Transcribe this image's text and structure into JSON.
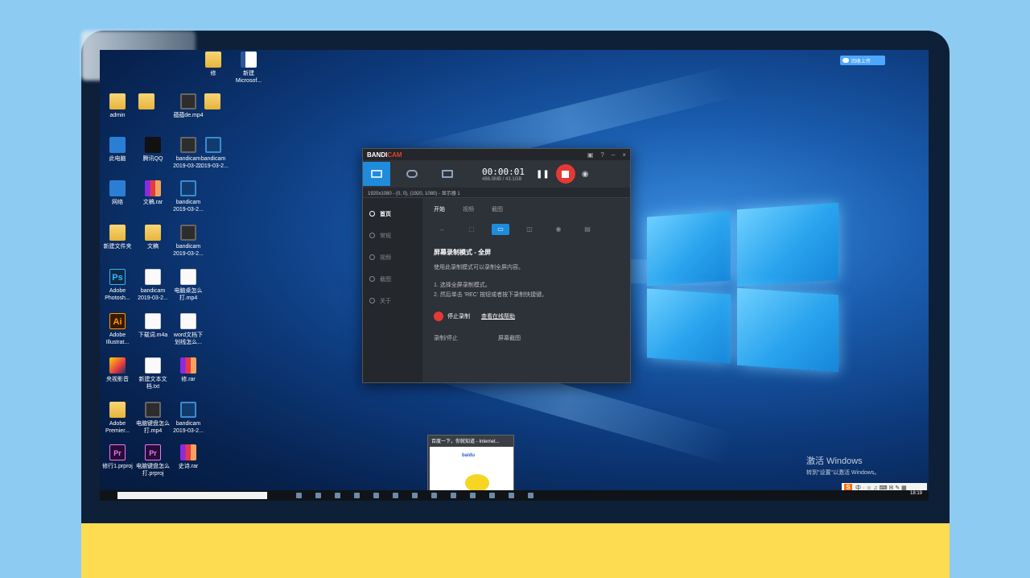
{
  "desktop": {
    "icons": [
      {
        "label": "修",
        "glyph": "folder"
      },
      {
        "label": "新建 Microsof...",
        "glyph": "word"
      },
      {
        "label": "admin",
        "glyph": "folder"
      },
      {
        "label": "",
        "glyph": "folder"
      },
      {
        "label": "蕴蕴de.mp4",
        "glyph": "video"
      },
      {
        "label": "",
        "glyph": "folder"
      },
      {
        "label": "此电脑",
        "glyph": "blue"
      },
      {
        "label": "腾讯QQ",
        "glyph": "qq"
      },
      {
        "label": "bandicam 2019-03-2...",
        "glyph": "video"
      },
      {
        "label": "bandicam 2019-03-2...",
        "glyph": "vid2"
      },
      {
        "label": "网络",
        "glyph": "blue"
      },
      {
        "label": "文稿.rar",
        "glyph": "rar"
      },
      {
        "label": "bandicam 2019-03-2...",
        "glyph": "vid2"
      },
      {
        "label": "新建文件夹",
        "glyph": "folder"
      },
      {
        "label": "文稿",
        "glyph": "folder"
      },
      {
        "label": "bandicam 2019-03-2...",
        "glyph": "video"
      },
      {
        "label": "Adobe Photosh...",
        "glyph": "ps"
      },
      {
        "label": "bandicam 2019-03-2...",
        "glyph": "white"
      },
      {
        "label": "电脑桌怎么 打.mp4",
        "glyph": "white"
      },
      {
        "label": "Adobe Illustrat...",
        "glyph": "ai"
      },
      {
        "label": "下载词.m4a",
        "glyph": "white"
      },
      {
        "label": "word文档下 划线怎么...",
        "glyph": "white"
      },
      {
        "label": "央视影音",
        "glyph": "yellow"
      },
      {
        "label": "新建文本文 档.txt",
        "glyph": "white"
      },
      {
        "label": "修.rar",
        "glyph": "rar"
      },
      {
        "label": "Adobe Premier...",
        "glyph": "folder"
      },
      {
        "label": "电脑键盘怎么 打.mp4",
        "glyph": "video"
      },
      {
        "label": "bandicam 2019-03-2...",
        "glyph": "vid2"
      },
      {
        "label": "修行1.prproj",
        "glyph": "pr"
      },
      {
        "label": "电脑键盘怎么 打.prproj",
        "glyph": "pr"
      },
      {
        "label": "史诗.rar",
        "glyph": "rar"
      }
    ]
  },
  "bandicam": {
    "brand_main": "BANDI",
    "brand_accent": "CAM",
    "controls": [
      "▣",
      "?",
      "–",
      "×"
    ],
    "timer": "00:00:01",
    "size": "486.0MB / 43.1GB",
    "pause": "❚❚",
    "camera": "◉",
    "resolution": "1920x1080 - (0, 0), (1920, 1080) - 显示器 1",
    "nav": [
      "首页",
      "常规",
      "视频",
      "截图",
      "关于"
    ],
    "subtabs": [
      "开始",
      "视频",
      "截图"
    ],
    "mode_icons": [
      "←",
      "⬚",
      "▭",
      "◫",
      "◉",
      "▤"
    ],
    "mode_title": "屏幕录制模式 - 全屏",
    "mode_desc": "使用此录制模式可以录制全屏内容。",
    "steps": [
      "1. 选择全屏录制模式。",
      "2. 然后单击 'REC' 按钮或者按下录制快捷键。"
    ],
    "stop_label": "停止录制",
    "help_label": "查看在线帮助",
    "hotkey_1": "录制/停止",
    "hotkey_2": "屏幕截图"
  },
  "preview": {
    "title": "百度一下，你就知道 - Internet...",
    "logo": "baidu"
  },
  "cloud_button": "回收上传",
  "sogou": {
    "s": "S",
    "text": "中 · ☺ ♫ ⌨ ✉ ✎ ▦"
  },
  "activation": {
    "line1": "激活 Windows",
    "line2": "转到\"设置\"以激活 Windows。"
  },
  "tray": {
    "time": "18:19"
  },
  "colors": {
    "accent": "#1f8bdc",
    "record": "#e53935",
    "base": "#fddc52",
    "background": "#8ecbf2"
  }
}
